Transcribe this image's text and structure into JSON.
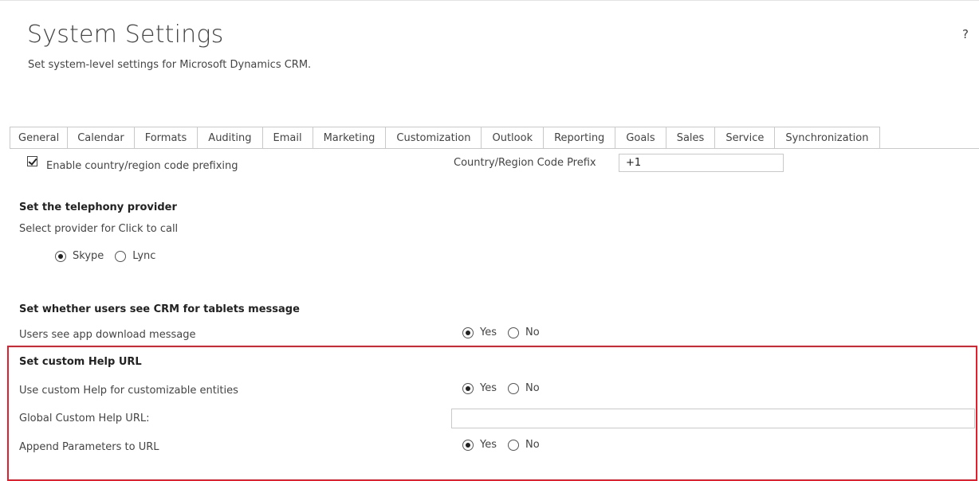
{
  "header": {
    "title": "System Settings",
    "subtitle": "Set system-level settings for Microsoft Dynamics CRM.",
    "help_label": "?"
  },
  "tabs": [
    {
      "label": "General",
      "active": true
    },
    {
      "label": "Calendar"
    },
    {
      "label": "Formats"
    },
    {
      "label": "Auditing"
    },
    {
      "label": "Email"
    },
    {
      "label": "Marketing"
    },
    {
      "label": "Customization"
    },
    {
      "label": "Outlook"
    },
    {
      "label": "Reporting"
    },
    {
      "label": "Goals"
    },
    {
      "label": "Sales"
    },
    {
      "label": "Service"
    },
    {
      "label": "Synchronization"
    }
  ],
  "country_prefix": {
    "checkbox_label": "Enable country/region code prefixing",
    "checked": true,
    "prefix_label": "Country/Region Code Prefix",
    "prefix_value": "+1"
  },
  "telephony": {
    "heading": "Set the telephony provider",
    "description": "Select provider for Click to call",
    "options": [
      {
        "label": "Skype",
        "selected": true
      },
      {
        "label": "Lync",
        "selected": false
      }
    ]
  },
  "tablets": {
    "heading": "Set whether users see CRM for tablets message",
    "label": "Users see app download message",
    "yes_label": "Yes",
    "no_label": "No",
    "selected": "Yes"
  },
  "custom_help": {
    "heading": "Set custom Help URL",
    "use_label": "Use custom Help for customizable entities",
    "use_selected": "Yes",
    "url_label": "Global Custom Help URL:",
    "url_value": "",
    "append_label": "Append Parameters to URL",
    "append_selected": "Yes",
    "yes_label": "Yes",
    "no_label": "No"
  },
  "colors": {
    "highlight": "#e0202c",
    "border": "#c9c9c9",
    "text": "#444444"
  }
}
